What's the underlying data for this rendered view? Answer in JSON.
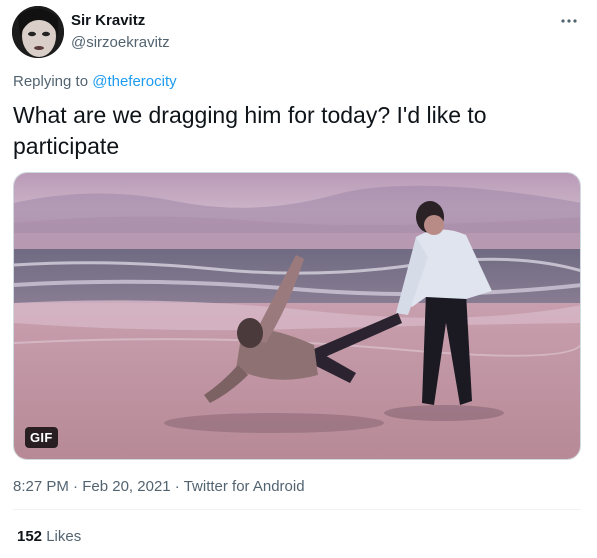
{
  "author": {
    "display_name": "Sir Kravitz",
    "handle": "@sirzoekravitz"
  },
  "reply": {
    "prefix": "Replying to ",
    "target": "@theferocity"
  },
  "tweet_text": "What are we dragging him for today? I'd like to participate",
  "media": {
    "badge": "GIF"
  },
  "meta": {
    "time": "8:27 PM",
    "separator1": " · ",
    "date": "Feb 20, 2021",
    "separator2": " · ",
    "source": "Twitter for Android"
  },
  "stats": {
    "likes_count": "152",
    "likes_label": " Likes"
  },
  "icons": {
    "more": "more-options-icon"
  }
}
